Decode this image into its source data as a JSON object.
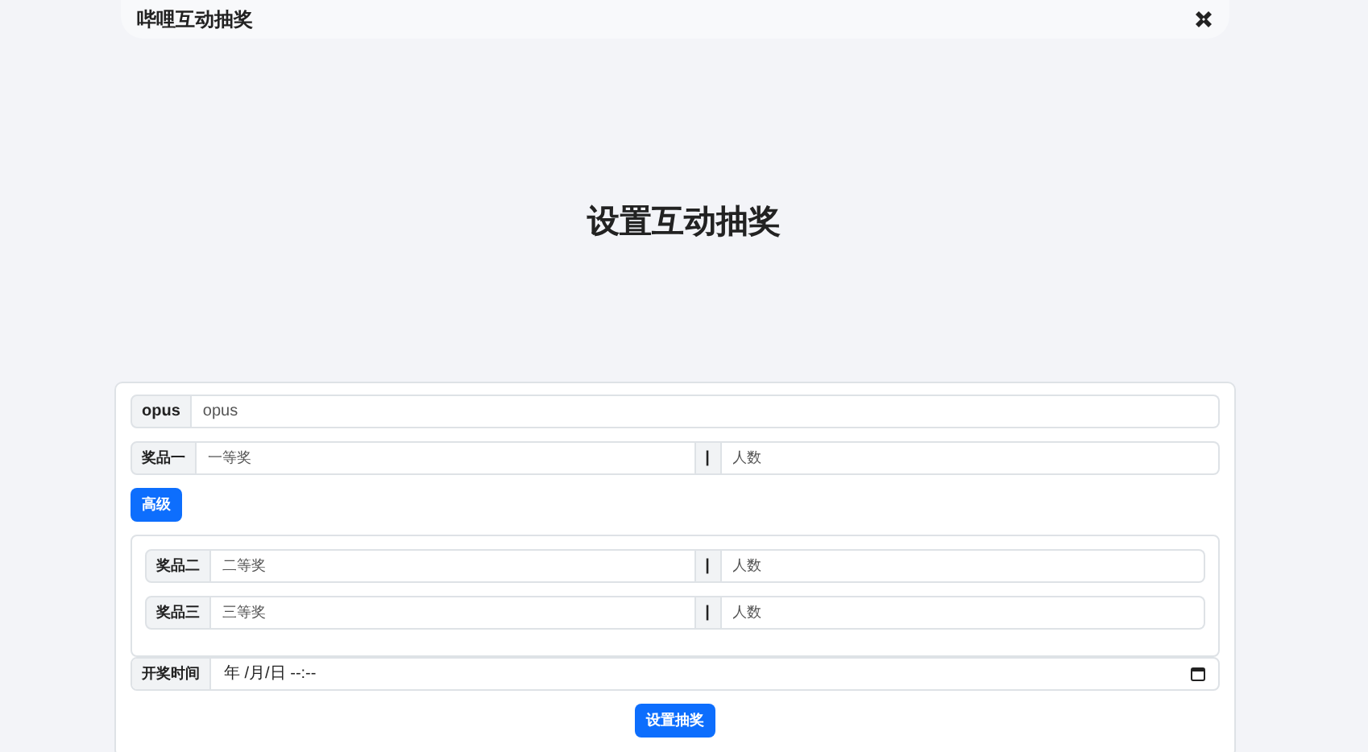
{
  "navbar": {
    "brand": "哔哩互动抽奖"
  },
  "heading": "设置互动抽奖",
  "form": {
    "opus": {
      "label": "opus",
      "placeholder": "opus"
    },
    "prizes": [
      {
        "label": "奖品一",
        "placeholder": "一等奖",
        "separator": "|",
        "count_placeholder": "人数"
      }
    ],
    "advanced_button": "高级",
    "advanced": {
      "prizes": [
        {
          "label": "奖品二",
          "placeholder": "二等奖",
          "separator": "|",
          "count_placeholder": "人数"
        },
        {
          "label": "奖品三",
          "placeholder": "三等奖",
          "separator": "|",
          "count_placeholder": "人数"
        }
      ]
    },
    "draw_time": {
      "label": "开奖时间",
      "value": "年 /月/日 --:--"
    },
    "submit": "设置抽奖"
  }
}
